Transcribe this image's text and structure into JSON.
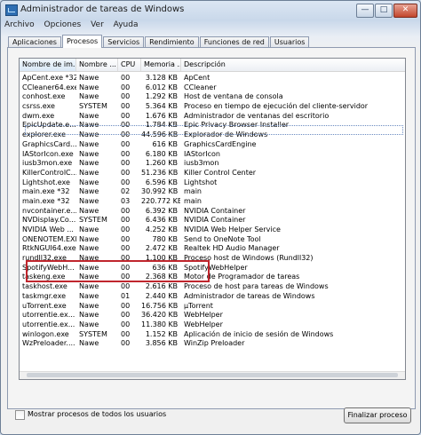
{
  "window": {
    "title": "Administrador de tareas de Windows"
  },
  "titlebar": {
    "min": "—",
    "max": "□",
    "close": "✕"
  },
  "menu": [
    "Archivo",
    "Opciones",
    "Ver",
    "Ayuda"
  ],
  "tabs": [
    "Aplicaciones",
    "Procesos",
    "Servicios",
    "Rendimiento",
    "Funciones de red",
    "Usuarios"
  ],
  "active_tab": "Procesos",
  "columns": [
    "Nombre de im...",
    "Nombre ...",
    "CPU",
    "Memoria ...",
    "Descripción"
  ],
  "processes": [
    {
      "name": "ApCent.exe *32",
      "user": "Nawe",
      "cpu": "00",
      "memory": "3.128 KB",
      "description": "ApCent"
    },
    {
      "name": "CCleaner64.exe",
      "user": "Nawe",
      "cpu": "00",
      "memory": "6.012 KB",
      "description": "CCleaner"
    },
    {
      "name": "conhost.exe",
      "user": "Nawe",
      "cpu": "00",
      "memory": "1.292 KB",
      "description": "Host de ventana de consola"
    },
    {
      "name": "csrss.exe",
      "user": "SYSTEM",
      "cpu": "00",
      "memory": "5.364 KB",
      "description": "Proceso en tiempo de ejecución del cliente-servidor"
    },
    {
      "name": "dwm.exe",
      "user": "Nawe",
      "cpu": "00",
      "memory": "1.676 KB",
      "description": "Administrador de ventanas del escritorio"
    },
    {
      "name": "EpicUpdate.e...",
      "user": "Nawe",
      "cpu": "00",
      "memory": "1.784 KB",
      "description": "Epic Privacy Browser Installer"
    },
    {
      "name": "explorer.exe",
      "user": "Nawe",
      "cpu": "00",
      "memory": "44.596 KB",
      "description": "Explorador de Windows"
    },
    {
      "name": "GraphicsCard...",
      "user": "Nawe",
      "cpu": "00",
      "memory": "616 KB",
      "description": "GraphicsCardEngine"
    },
    {
      "name": "IAStorIcon.exe",
      "user": "Nawe",
      "cpu": "00",
      "memory": "6.180 KB",
      "description": "IAStorIcon"
    },
    {
      "name": "iusb3mon.exe",
      "user": "Nawe",
      "cpu": "00",
      "memory": "1.260 KB",
      "description": "iusb3mon"
    },
    {
      "name": "KillerControlC...",
      "user": "Nawe",
      "cpu": "00",
      "memory": "51.236 KB",
      "description": "Killer Control Center"
    },
    {
      "name": "Lightshot.exe",
      "user": "Nawe",
      "cpu": "00",
      "memory": "6.596 KB",
      "description": "Lightshot"
    },
    {
      "name": "main.exe *32",
      "user": "Nawe",
      "cpu": "02",
      "memory": "30.992 KB",
      "description": "main"
    },
    {
      "name": "main.exe *32",
      "user": "Nawe",
      "cpu": "03",
      "memory": "220.772 KB",
      "description": "main"
    },
    {
      "name": "nvcontainer.e...",
      "user": "Nawe",
      "cpu": "00",
      "memory": "6.392 KB",
      "description": "NVIDIA Container"
    },
    {
      "name": "NVDisplay.Co...",
      "user": "SYSTEM",
      "cpu": "00",
      "memory": "6.436 KB",
      "description": "NVIDIA Container"
    },
    {
      "name": "NVIDIA Web ...",
      "user": "Nawe",
      "cpu": "00",
      "memory": "4.252 KB",
      "description": "NVIDIA Web Helper Service"
    },
    {
      "name": "ONENOTEM.EXE",
      "user": "Nawe",
      "cpu": "00",
      "memory": "780 KB",
      "description": "Send to OneNote Tool"
    },
    {
      "name": "RtkNGUI64.exe",
      "user": "Nawe",
      "cpu": "00",
      "memory": "2.472 KB",
      "description": "Realtek HD Audio Manager"
    },
    {
      "name": "rundll32.exe",
      "user": "Nawe",
      "cpu": "00",
      "memory": "1.100 KB",
      "description": "Proceso host de Windows (Rundll32)"
    },
    {
      "name": "SpotifyWebH...",
      "user": "Nawe",
      "cpu": "00",
      "memory": "636 KB",
      "description": "SpotifyWebHelper"
    },
    {
      "name": "taskeng.exe",
      "user": "Nawe",
      "cpu": "00",
      "memory": "2.368 KB",
      "description": "Motor de Programador de tareas"
    },
    {
      "name": "taskhost.exe",
      "user": "Nawe",
      "cpu": "00",
      "memory": "2.616 KB",
      "description": "Proceso de host para tareas de Windows"
    },
    {
      "name": "taskmgr.exe",
      "user": "Nawe",
      "cpu": "01",
      "memory": "2.440 KB",
      "description": "Administrador de tareas de Windows"
    },
    {
      "name": "uTorrent.exe",
      "user": "Nawe",
      "cpu": "00",
      "memory": "16.756 KB",
      "description": "µTorrent"
    },
    {
      "name": "utorrentie.ex...",
      "user": "Nawe",
      "cpu": "00",
      "memory": "36.420 KB",
      "description": "WebHelper"
    },
    {
      "name": "utorrentie.ex...",
      "user": "Nawe",
      "cpu": "00",
      "memory": "11.380 KB",
      "description": "WebHelper"
    },
    {
      "name": "winlogon.exe",
      "user": "SYSTEM",
      "cpu": "00",
      "memory": "1.152 KB",
      "description": "Aplicación de inicio de sesión de Windows"
    },
    {
      "name": "WzPreloader....",
      "user": "Nawe",
      "cpu": "00",
      "memory": "3.856 KB",
      "description": "WinZip Preloader"
    }
  ],
  "show_all_label": "Mostrar procesos de todos los usuarios",
  "end_process_label": "Finalizar proceso"
}
